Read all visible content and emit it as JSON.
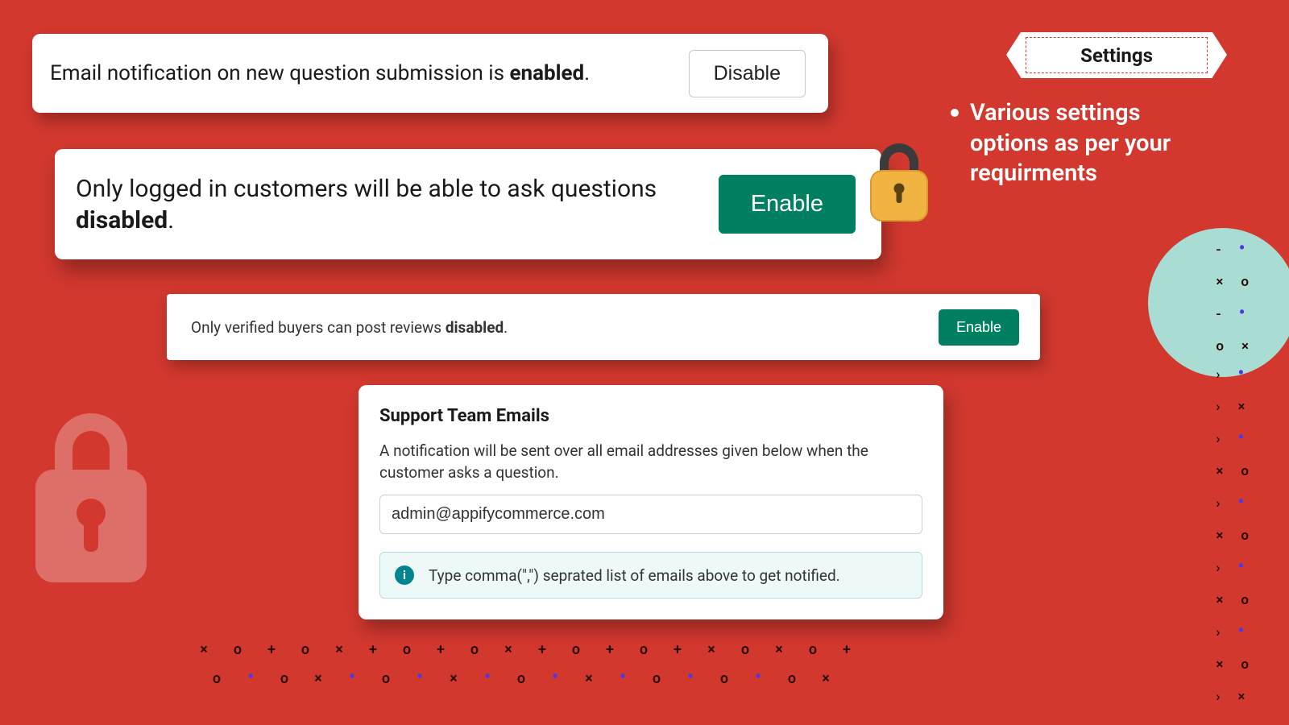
{
  "card1": {
    "text_prefix": "Email notification on new question submission is ",
    "text_strong": "enabled",
    "text_suffix": ".",
    "button": "Disable"
  },
  "card2": {
    "text_prefix": "Only logged in customers will be able to ask questions ",
    "text_strong": "disabled",
    "text_suffix": ".",
    "button": "Enable"
  },
  "card3": {
    "text_prefix": "Only verified buyers can post reviews ",
    "text_strong": "disabled",
    "text_suffix": ".",
    "button": "Enable"
  },
  "card4": {
    "title": "Support Team Emails",
    "description": "A notification will be sent over all email addresses given below when the customer asks a question.",
    "email_value": "admin@appifycommerce.com",
    "info_icon_letter": "i",
    "info_message": "Type comma(\",\") seprated list of emails above to get notified."
  },
  "ribbon": {
    "label": "Settings"
  },
  "side_text": "Various settings options as per your requirments"
}
